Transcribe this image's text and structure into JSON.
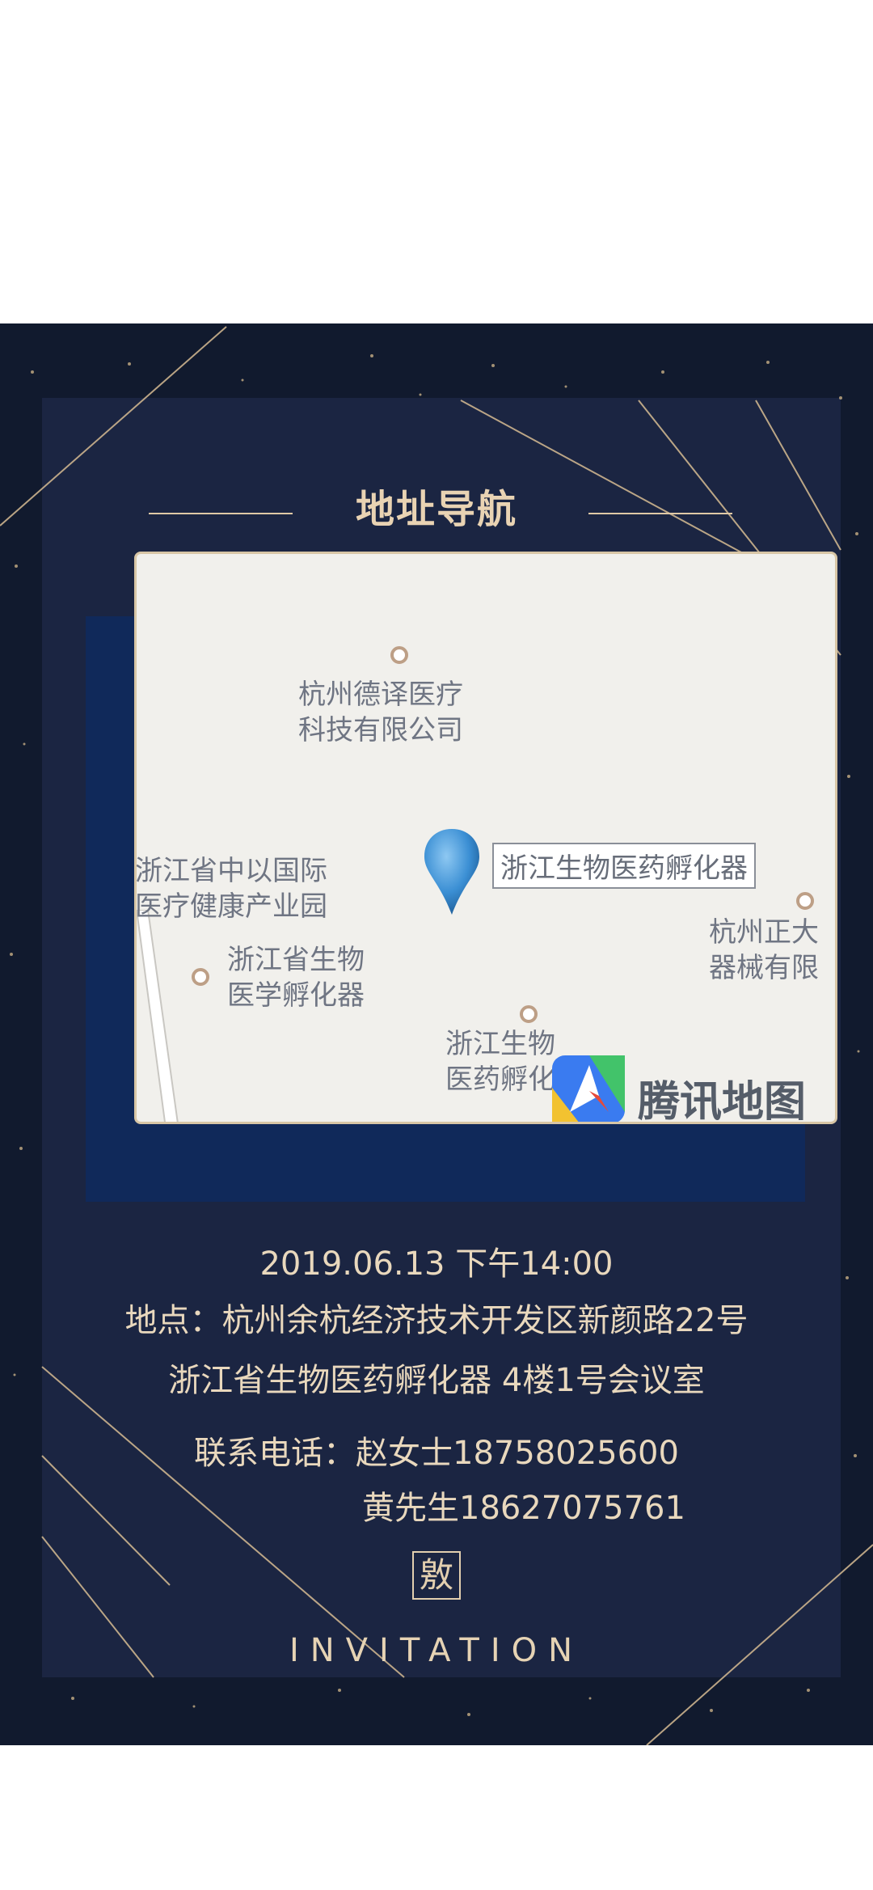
{
  "colors": {
    "card_bg": "#111a2e",
    "gold": "#e9d3b3",
    "map_bg": "#f1f0ec",
    "block": "#10295a"
  },
  "header": {
    "title": "地址导航"
  },
  "map": {
    "pin_label": "浙江生物医药孵化器",
    "logo_text": "腾讯地图",
    "labels": {
      "company1": "杭州德译医疗\n科技有限公司",
      "park": "浙江省中以国际\n医疗健康产业园",
      "incubator1": "浙江省生物\n医学孵化器",
      "incubator2": "浙江生物\n医药孵化",
      "company2": "杭州正大\n器械有限"
    },
    "icons": [
      "map-pin-icon",
      "tencent-map-logo-icon"
    ]
  },
  "info": {
    "datetime": "2019.06.13 下午14:00",
    "address1": "地点：杭州余杭经济技术开发区新颜路22号",
    "address2": "浙江省生物医药孵化器 4楼1号会议室",
    "contact1": "联系电话：赵女士18758025600",
    "contact2": "黄先生18627075761"
  },
  "footer": {
    "seal": "敫",
    "invitation": "INVITATION"
  }
}
